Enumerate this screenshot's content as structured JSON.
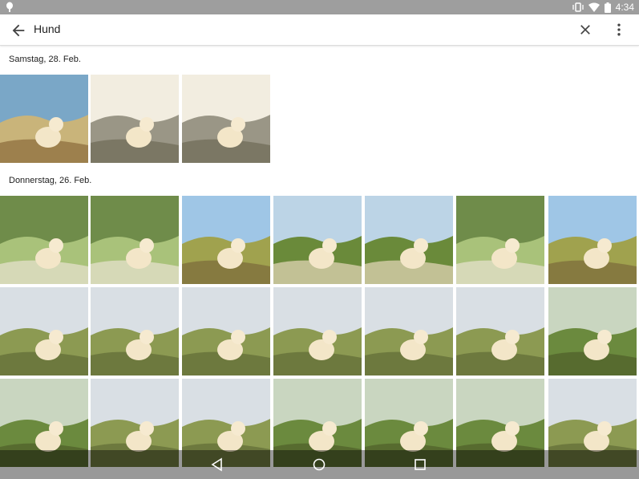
{
  "status_bar": {
    "time": "4:34",
    "icons": [
      "notification-icon",
      "vibrate-icon",
      "wifi-icon",
      "battery-icon"
    ]
  },
  "search": {
    "query": "Hund",
    "back_icon": "arrow-back-icon",
    "clear_icon": "close-icon",
    "menu_icon": "more-vert-icon"
  },
  "sections": [
    {
      "date": "Samstag, 28. Feb.",
      "photo_count": 3
    },
    {
      "date": "Donnerstag, 26. Feb.",
      "photo_count": 21
    }
  ],
  "nav_bar": {
    "icons": [
      "nav-back-icon",
      "nav-home-icon",
      "nav-recents-icon"
    ]
  },
  "colors": {
    "status_bar": "#9e9e9e",
    "accent": "#757575"
  }
}
